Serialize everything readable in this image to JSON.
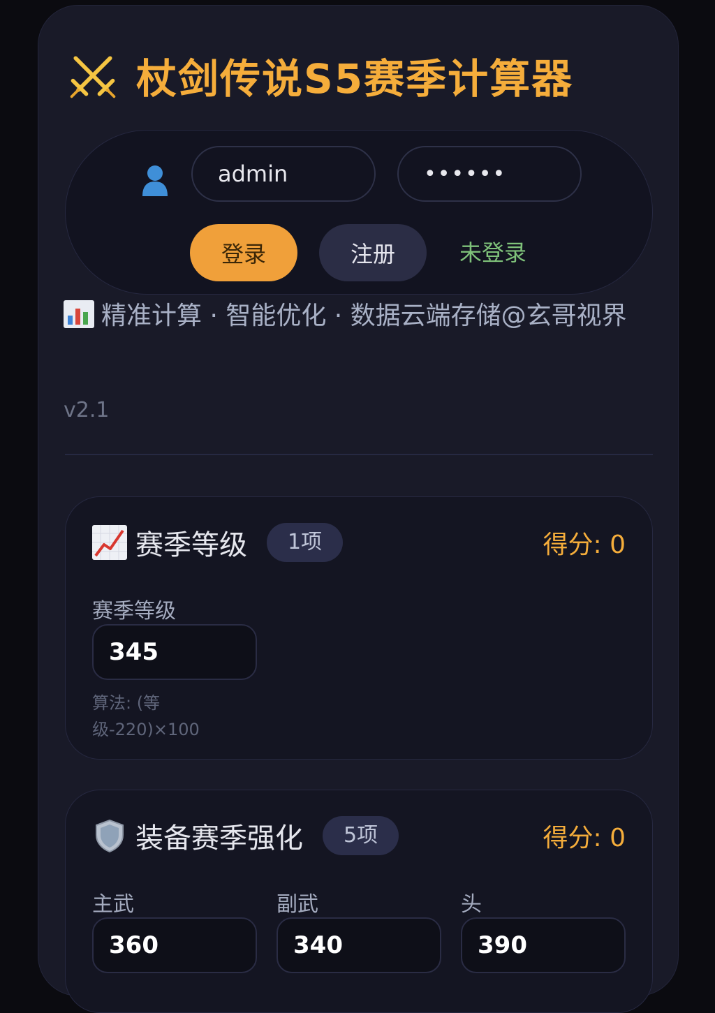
{
  "app": {
    "title": "杖剑传说S5赛季计算器",
    "accent_color": "#f5ad3b",
    "icon": "crossed-swords-icon"
  },
  "auth": {
    "user_icon": "user-icon",
    "username_value": "admin",
    "password_value": "••••••",
    "login_label": "登录",
    "register_label": "注册",
    "status_text": "未登录",
    "status_color": "#7fc27a"
  },
  "header": {
    "subtitle_icon": "bar-chart-icon",
    "subtitle": "精准计算 · 智能优化 · 数据云端存储@玄哥视界",
    "version": "v2.1"
  },
  "cards": {
    "level": {
      "icon": "line-chart-icon",
      "title": "赛季等级",
      "badge": "1项",
      "score": "得分: 0",
      "fields": [
        {
          "label": "赛季等级",
          "value": "345"
        }
      ],
      "formula": "算法: (等级-220)×100"
    },
    "equipment": {
      "icon": "shield-icon",
      "title": "装备赛季强化",
      "badge": "5项",
      "score": "得分: 0",
      "fields": [
        {
          "label": "主武",
          "value": "360"
        },
        {
          "label": "副武",
          "value": "340"
        },
        {
          "label": "头",
          "value": "390"
        }
      ]
    }
  }
}
